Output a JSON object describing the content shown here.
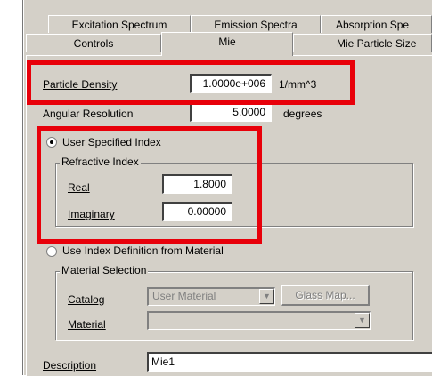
{
  "tabs": {
    "row_back": [
      "Excitation Spectrum",
      "Emission Spectra",
      "Absorption Spe"
    ],
    "row_front": [
      "Controls",
      "Mie",
      "Mie Particle Size"
    ]
  },
  "particle_density": {
    "label": "Particle Density",
    "value": "1.0000e+006",
    "unit": "1/mm^3"
  },
  "angular_resolution": {
    "label": "Angular Resolution",
    "value": "5.0000",
    "unit": "degrees"
  },
  "user_specified_index": {
    "radio_label": "User Specified Index",
    "group_title": "Refractive Index",
    "real_label": "Real",
    "real_value": "1.8000",
    "imaginary_label": "Imaginary",
    "imaginary_value": "0.00000"
  },
  "material_index": {
    "radio_label": "Use Index Definition from Material",
    "group_title": "Material Selection",
    "catalog_label": "Catalog",
    "catalog_value": "User Material",
    "glass_map_button": "Glass Map...",
    "material_label": "Material",
    "material_value": ""
  },
  "description": {
    "label": "Description",
    "value": "Mie1"
  },
  "highlight_color": "#e8000a"
}
